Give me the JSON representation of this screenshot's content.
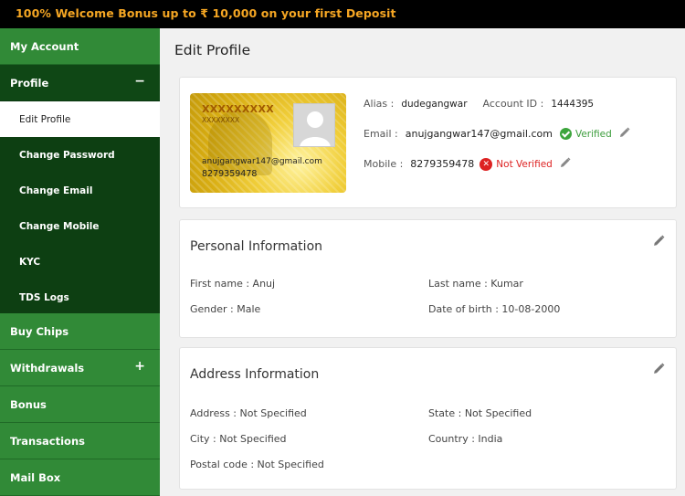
{
  "banner": {
    "text": "100% Welcome Bonus up to ₹ 10,000 on your first Deposit"
  },
  "sidebar": {
    "my_account": "My Account",
    "profile": "Profile",
    "profile_sign": "−",
    "sub_items": [
      "Edit Profile",
      "Change Password",
      "Change Email",
      "Change Mobile",
      "KYC",
      "TDS Logs"
    ],
    "buy_chips": "Buy Chips",
    "withdrawals": "Withdrawals",
    "withdrawals_sign": "+",
    "bonus": "Bonus",
    "transactions": "Transactions",
    "mail_box": "Mail Box"
  },
  "page": {
    "title": "Edit Profile"
  },
  "profile_card": {
    "card_name": "XXXXXXXXX",
    "card_sub": "XXXXXXXX",
    "card_email": "anujgangwar147@gmail.com",
    "card_mobile": "8279359478",
    "alias_label": "Alias :",
    "alias_value": "dudegangwar",
    "account_id_label": "Account ID :",
    "account_id_value": "1444395",
    "email_label": "Email :",
    "email_value": "anujgangwar147@gmail.com",
    "email_status": "Verified",
    "mobile_label": "Mobile :",
    "mobile_value": "8279359478",
    "mobile_status": "Not Verified",
    "colors": {
      "verified": "#3c9d3c",
      "not_verified": "#dd2222"
    }
  },
  "personal": {
    "title": "Personal Information",
    "first_name": "First name : Anuj",
    "last_name": "Last name : Kumar",
    "gender": "Gender : Male",
    "dob": "Date of birth : 10-08-2000"
  },
  "address": {
    "title": "Address Information",
    "address": "Address : Not Specified",
    "state": "State : Not Specified",
    "city": "City : Not Specified",
    "country": "Country : India",
    "postal": "Postal code : Not Specified"
  },
  "icons": {
    "edit": "pencil-icon",
    "verified": "check-circle-icon",
    "not_verified": "x-circle-icon",
    "avatar": "user-avatar-icon"
  },
  "theme": {
    "sidebar_green": "#318a37",
    "sidebar_dark": "#0d3f12",
    "banner_accent": "#f5a623"
  }
}
